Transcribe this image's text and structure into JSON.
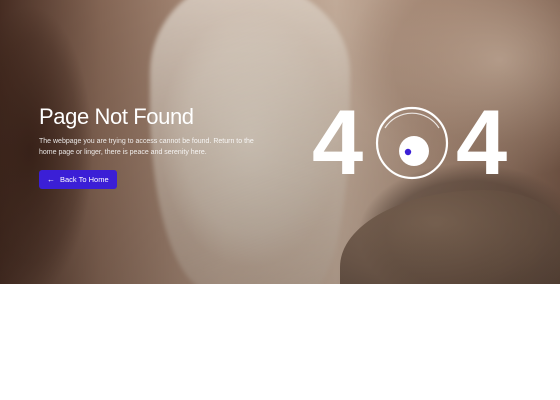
{
  "error": {
    "title": "Page Not Found",
    "description": "The webpage you are trying to access cannot be found. Return to the home page or linger, there is peace and serenity here.",
    "code_digit_left": "4",
    "code_digit_right": "4"
  },
  "actions": {
    "back_home_label": "Back To Home",
    "back_home_icon": "arrow-left-icon"
  },
  "colors": {
    "accent": "#3b1fd6",
    "text": "#ffffff"
  }
}
